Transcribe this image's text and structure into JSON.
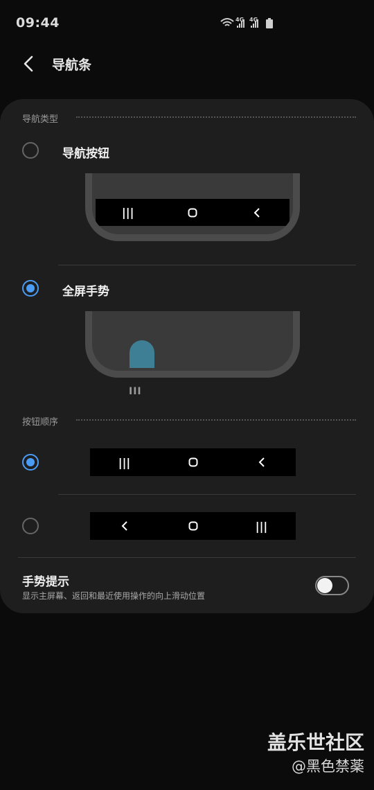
{
  "status_bar": {
    "time": "09:44",
    "network": "4G",
    "icons": [
      "wifi-icon",
      "signal-icon",
      "signal-icon",
      "battery-icon"
    ]
  },
  "header": {
    "back_icon": "chevron-left-icon",
    "title": "导航条"
  },
  "nav_type": {
    "section_label": "导航类型",
    "options": [
      {
        "label": "导航按钮",
        "selected": false,
        "buttons": [
          "recents-icon",
          "home-icon",
          "back-icon"
        ]
      },
      {
        "label": "全屏手势",
        "selected": true,
        "handle": "III"
      }
    ]
  },
  "button_order": {
    "section_label": "按钮顺序",
    "options": [
      {
        "selected": true,
        "buttons": [
          "recents-icon",
          "home-icon",
          "back-icon"
        ]
      },
      {
        "selected": false,
        "buttons": [
          "back-icon",
          "home-icon",
          "recents-icon"
        ]
      }
    ]
  },
  "gesture_hint": {
    "title": "手势提示",
    "description": "显示主屏幕、返回和最近使用操作的向上滑动位置",
    "enabled": false
  },
  "colors": {
    "accent": "#4a9cf5",
    "card": "#1e1e1e",
    "background": "#0b0b0b"
  },
  "watermark": {
    "line1": "盖乐世社区",
    "line2": "@黑色禁薬"
  }
}
